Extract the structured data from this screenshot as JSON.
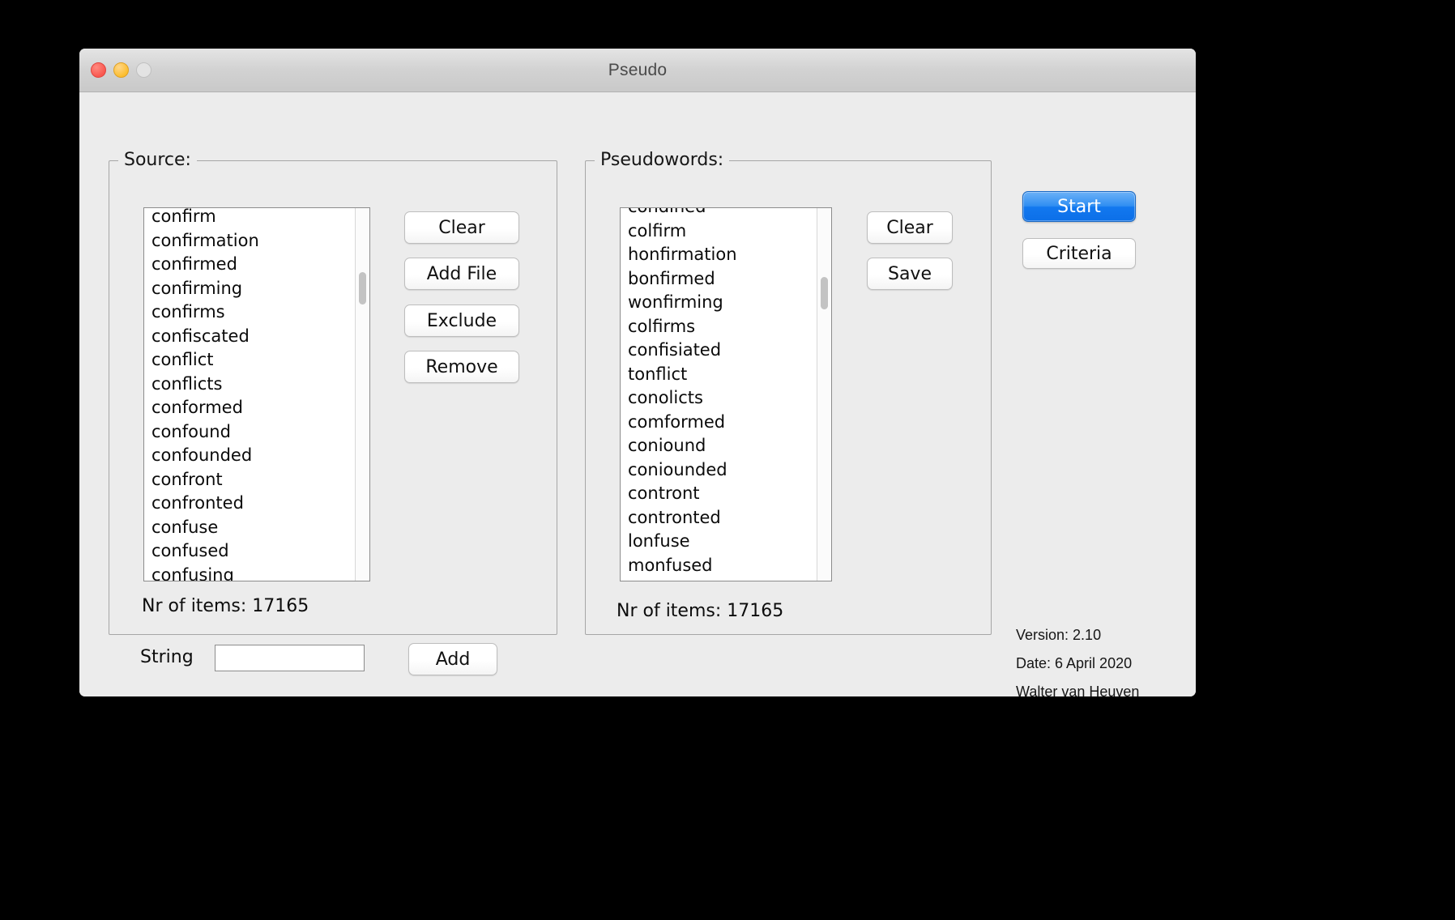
{
  "window": {
    "title": "Pseudo",
    "traffic_lights": [
      "close-button",
      "minimize-button",
      "zoom-button"
    ]
  },
  "source_panel": {
    "legend": "Source:",
    "items": [
      "confirm",
      "confirmation",
      "confirmed",
      "confirming",
      "confirms",
      "confiscated",
      "conflict",
      "conflicts",
      "conformed",
      "confound",
      "confounded",
      "confront",
      "confronted",
      "confuse",
      "confused",
      "confusing"
    ],
    "buttons": {
      "clear": "Clear",
      "add_file": "Add File",
      "exclude": "Exclude",
      "remove": "Remove"
    },
    "counter_label": "Nr of items:",
    "counter_value": "17165",
    "counter_text": "Nr of items:  17165",
    "string_label": "String",
    "string_value": "",
    "string_placeholder": "",
    "add_button": "Add"
  },
  "pseudo_panel": {
    "legend": "Pseudowords:",
    "items": [
      "condined",
      "colfirm",
      "honfirmation",
      "bonfirmed",
      "wonfirming",
      "colfirms",
      "confisiated",
      "tonflict",
      "conolicts",
      "comformed",
      "coniound",
      "coniounded",
      "contront",
      "contronted",
      "lonfuse",
      "monfused"
    ],
    "buttons": {
      "clear": "Clear",
      "save": "Save"
    },
    "counter_label": "Nr of items:",
    "counter_value": "17165",
    "counter_text": "Nr of items:  17165"
  },
  "actions": {
    "start": "Start",
    "criteria": "Criteria"
  },
  "info": {
    "version": "Version: 2.10",
    "date": "Date: 6 April 2020",
    "author": "Walter van Heuven"
  },
  "colors": {
    "window_bg": "#ececec",
    "titlebar_top": "#e4e4e4",
    "titlebar_bottom": "#c9c9c9",
    "default_button_accent": "#1278ef",
    "close_dot": "#f9574f",
    "minimize_dot": "#fcbe30",
    "zoom_dot": "#e3e3e3",
    "list_bg": "#ffffff",
    "border": "#a6a6a6"
  }
}
